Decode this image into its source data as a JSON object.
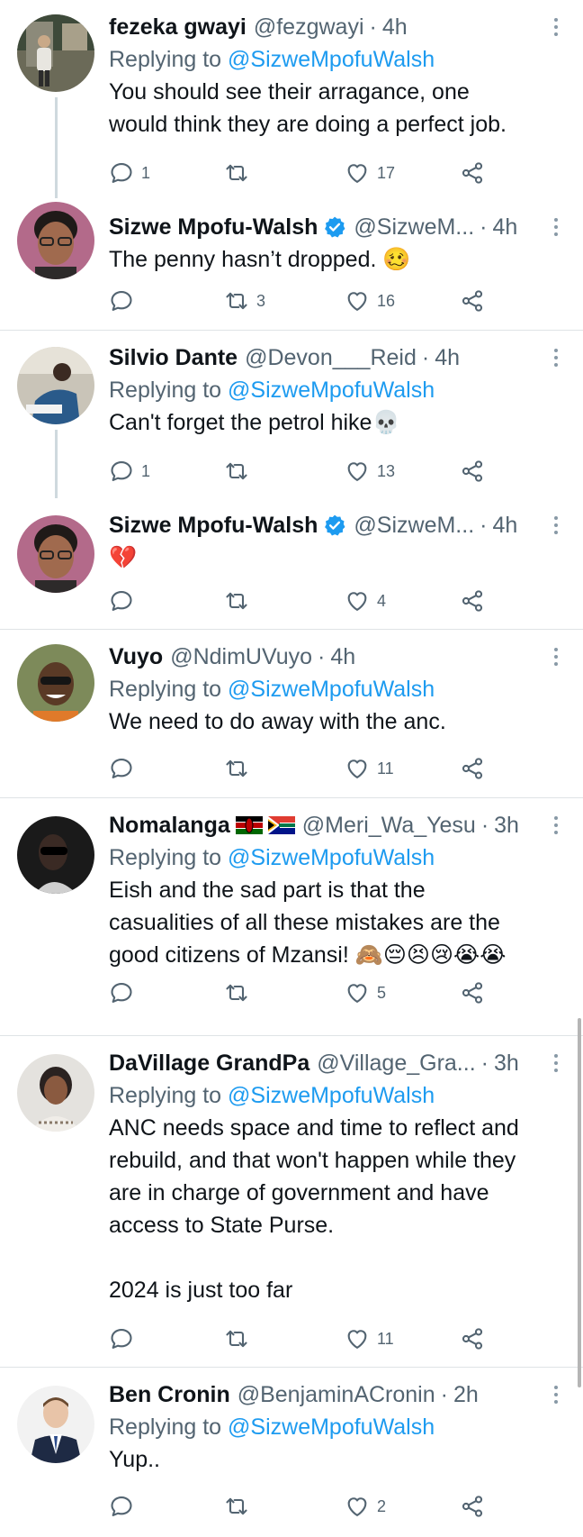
{
  "tweets": [
    {
      "name": "fezeka gwayi",
      "handle": "@fezgwayi",
      "time": "4h",
      "replying_prefix": "Replying to ",
      "replying_to": "@SizweMpofuWalsh",
      "text": "You should see their arragance, one\nwould think they are doing a perfect job.",
      "replies": "1",
      "retweets": "",
      "likes": "17"
    },
    {
      "name": "Sizwe Mpofu-Walsh",
      "handle": "@SizweM...",
      "time": "4h",
      "verified": true,
      "text": "The penny hasn’t dropped. 🥴",
      "replies": "",
      "retweets": "3",
      "likes": "16"
    },
    {
      "name": "Silvio Dante",
      "handle": "@Devon___Reid",
      "time": "4h",
      "replying_prefix": "Replying to ",
      "replying_to": "@SizweMpofuWalsh",
      "text": "Can't forget the petrol hike💀",
      "replies": "1",
      "retweets": "",
      "likes": "13"
    },
    {
      "name": "Sizwe Mpofu-Walsh",
      "handle": "@SizweM...",
      "time": "4h",
      "verified": true,
      "text": "💔",
      "replies": "",
      "retweets": "",
      "likes": "4"
    },
    {
      "name": "Vuyo",
      "handle": "@NdimUVuyo",
      "time": "4h",
      "replying_prefix": "Replying to ",
      "replying_to": "@SizweMpofuWalsh",
      "text": "We need to do away with the anc.",
      "replies": "",
      "retweets": "",
      "likes": "11"
    },
    {
      "name": "Nomalanga",
      "handle": "@Meri_Wa_Yesu",
      "time": "3h",
      "flags": [
        "kenya-flag",
        "south-africa-flag"
      ],
      "replying_prefix": "Replying to ",
      "replying_to": "@SizweMpofuWalsh",
      "text": "Eish  and the sad part is that the\ncasualities of all these mistakes are the\ngood citizens of Mzansi! 🙈😔😣😢😭😭",
      "replies": "",
      "retweets": "",
      "likes": "5"
    },
    {
      "name": "DaVillage GrandPa",
      "handle": "@Village_Gra...",
      "time": "3h",
      "replying_prefix": "Replying to ",
      "replying_to": "@SizweMpofuWalsh",
      "text": "ANC needs space and time to reflect and\nrebuild, and that won't happen while they\nare in charge of government and have\naccess to State Purse.\n\n2024 is just too far",
      "replies": "",
      "retweets": "",
      "likes": "11"
    },
    {
      "name": "Ben Cronin",
      "handle": "@BenjaminACronin",
      "time": "2h",
      "replying_prefix": "Replying to ",
      "replying_to": "@SizweMpofuWalsh",
      "text": "Yup..",
      "replies": "",
      "retweets": "",
      "likes": "2"
    }
  ],
  "separator": "·",
  "colors": {
    "accent": "#1d9bf0",
    "secondary_text": "#536471",
    "divider": "#dfe3e6",
    "thread_line": "#cfd9de"
  },
  "icons": {
    "reply": "comment-bubble-icon",
    "retweet": "retweet-arrows-icon",
    "like": "heart-outline-icon",
    "share": "share-nodes-icon",
    "more": "more-vertical-dots-icon",
    "verified": "verified-badge-icon"
  }
}
